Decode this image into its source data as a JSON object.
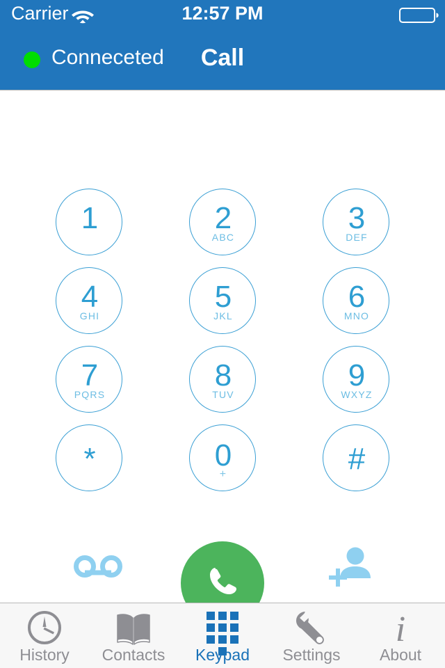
{
  "status_bar": {
    "carrier": "Carrier",
    "wifi_icon": "wifi-icon",
    "time": "12:57 PM",
    "battery_icon": "battery-icon"
  },
  "nav_bar": {
    "title": "Call",
    "connection_status": "Conneceted",
    "status_dot_color": "#00dd00",
    "background_color": "#2176bc"
  },
  "keypad": {
    "keys": [
      {
        "digit": "1",
        "letters": ""
      },
      {
        "digit": "2",
        "letters": "ABC"
      },
      {
        "digit": "3",
        "letters": "DEF"
      },
      {
        "digit": "4",
        "letters": "GHI"
      },
      {
        "digit": "5",
        "letters": "JKL"
      },
      {
        "digit": "6",
        "letters": "MNO"
      },
      {
        "digit": "7",
        "letters": "PQRS"
      },
      {
        "digit": "8",
        "letters": "TUV"
      },
      {
        "digit": "9",
        "letters": "WXYZ"
      },
      {
        "digit": "*",
        "letters": ""
      },
      {
        "digit": "0",
        "letters": "+"
      },
      {
        "digit": "#",
        "letters": ""
      }
    ],
    "key_color": "#2e9ed2",
    "border_color": "#3a9fd4"
  },
  "actions": {
    "voicemail_icon": "voicemail-icon",
    "call_icon": "phone-handset-icon",
    "call_button_color": "#4cb45c",
    "add_contact_icon": "add-contact-icon"
  },
  "tab_bar": {
    "active_index": 2,
    "active_color": "#1a72b8",
    "inactive_color": "#8e8e93",
    "tabs": [
      {
        "label": "History",
        "icon": "clock-icon"
      },
      {
        "label": "Contacts",
        "icon": "book-icon"
      },
      {
        "label": "Keypad",
        "icon": "keypad-grid-icon"
      },
      {
        "label": "Settings",
        "icon": "wrench-icon"
      },
      {
        "label": "About",
        "icon": "info-icon"
      }
    ]
  }
}
